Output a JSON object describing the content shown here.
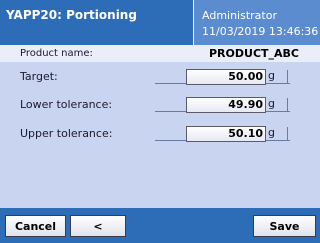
{
  "header": {
    "title": "YAPP20: Portioning",
    "user": "Administrator",
    "datetime": "11/03/2019 13:46:36"
  },
  "product": {
    "label": "Product name:",
    "value": "PRODUCT_ABC"
  },
  "fields": [
    {
      "label": "Target:",
      "value": "50.00",
      "unit": "g"
    },
    {
      "label": "Lower tolerance:",
      "value": "49.90",
      "unit": "g"
    },
    {
      "label": "Upper tolerance:",
      "value": "50.10",
      "unit": "g"
    }
  ],
  "footer": {
    "cancel_label": "Cancel",
    "back_label": "<",
    "save_label": "Save"
  },
  "colors": {
    "title_bar": "#2d6cb7",
    "user_box": "#5a8ccf",
    "content_bg": "#c8d4f0"
  }
}
